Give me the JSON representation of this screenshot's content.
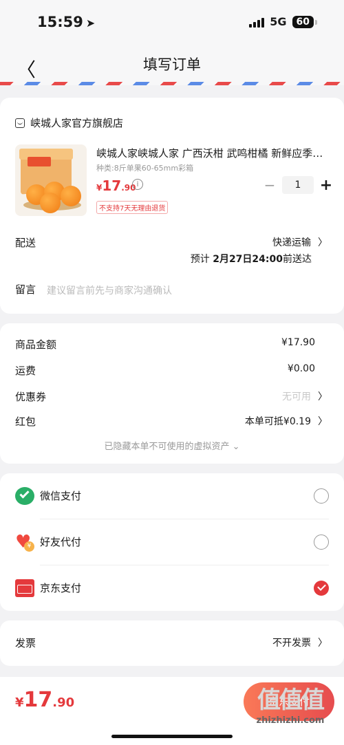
{
  "status": {
    "time": "15:59",
    "network": "5G",
    "battery": "60"
  },
  "nav": {
    "title": "填写订单"
  },
  "store": {
    "name": "峡城人家官方旗舰店"
  },
  "product": {
    "title": "峡城人家峡城人家 广西沃柑 武鸣柑橘 新鲜应季…",
    "spec": "种类:8斤单果60-65mm彩箱",
    "price_currency": "¥",
    "price_int": "17",
    "price_dec": ".90",
    "quantity": "1",
    "tag": "不支持7天无理由退货"
  },
  "delivery": {
    "label": "配送",
    "method": "快递运输",
    "eta_prefix": "预计",
    "eta_date": "2月27日24:00",
    "eta_suffix": "前送达"
  },
  "note": {
    "label": "留言",
    "placeholder": "建议留言前先与商家沟通确认"
  },
  "summary": {
    "goods_label": "商品金额",
    "goods_value": "¥17.90",
    "freight_label": "运费",
    "freight_value": "¥0.00",
    "coupon_label": "优惠券",
    "coupon_value": "无可用",
    "redpacket_label": "红包",
    "redpacket_value": "本单可抵¥0.19",
    "hidden_note": "已隐藏本单不可使用的虚拟资产 ⌄"
  },
  "payment": {
    "options": [
      {
        "label": "微信支付",
        "icon": "wechat-pay-icon",
        "selected": false
      },
      {
        "label": "好友代付",
        "icon": "friend-pay-icon",
        "selected": false
      },
      {
        "label": "京东支付",
        "icon": "jd-pay-icon",
        "selected": true
      }
    ]
  },
  "invoice": {
    "label": "发票",
    "value": "不开发票"
  },
  "footer": {
    "total_currency": "¥",
    "total_int": "17",
    "total_dec": ".90",
    "pay_button": "京东支付",
    "watermark": "值值值",
    "watermark_url": "zhizhizhi.com"
  },
  "colors": {
    "accent": "#e4393c",
    "wechat": "#2aae67"
  }
}
